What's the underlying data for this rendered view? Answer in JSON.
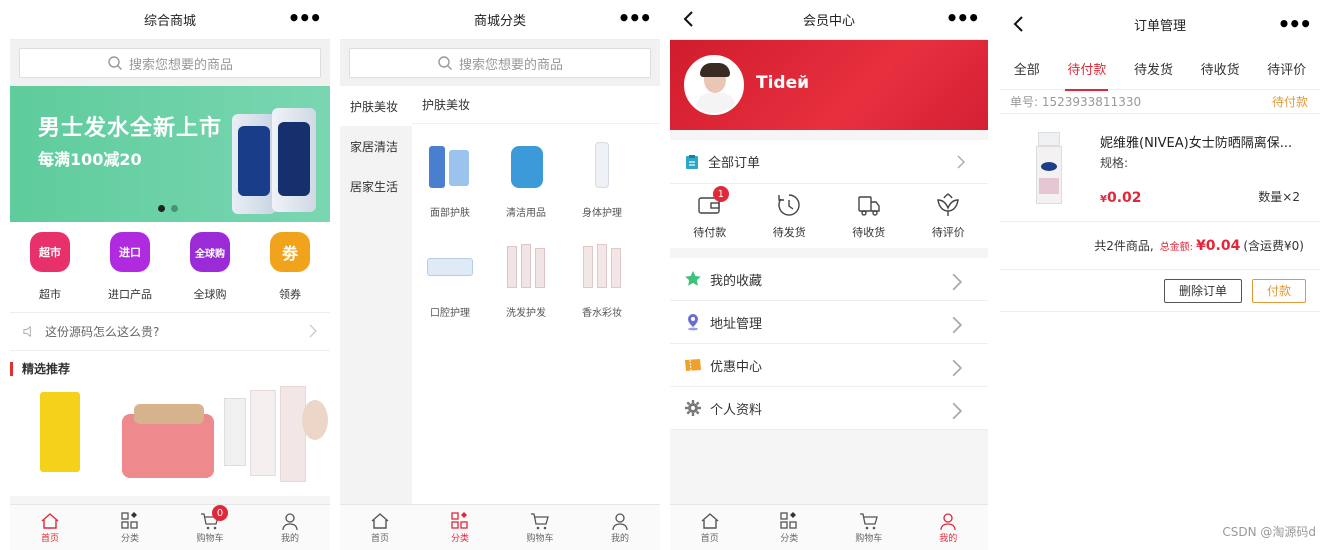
{
  "screens": {
    "home": {
      "title": "综合商城",
      "search_placeholder": "搜索您想要的商品",
      "banner": {
        "title": "男士发水全新上市",
        "sub": "每满100减20"
      },
      "categories": [
        {
          "icon": "supermarket-icon",
          "text": "超市",
          "label": "超市",
          "color": "#e8306a"
        },
        {
          "icon": "import-icon",
          "text": "进口",
          "label": "进口产品",
          "color": "#b02be0"
        },
        {
          "icon": "global-icon",
          "text": "全球购",
          "label": "全球购",
          "color": "#9b2bd6"
        },
        {
          "icon": "coupon-icon",
          "text": "劵",
          "label": "领券",
          "color": "#f2a31c"
        }
      ],
      "notice": "这份源码怎么这么贵?",
      "section_title": "精选推荐",
      "tabbar": [
        {
          "icon": "home-icon",
          "label": "首页"
        },
        {
          "icon": "category-icon",
          "label": "分类"
        },
        {
          "icon": "cart-icon",
          "label": "购物车"
        },
        {
          "icon": "user-icon",
          "label": "我的"
        }
      ],
      "cart_badge": "0"
    },
    "category": {
      "title": "商城分类",
      "search_placeholder": "搜索您想要的商品",
      "sidebar": [
        "护肤美妆",
        "家居清洁",
        "居家生活"
      ],
      "main_title": "护肤美妆",
      "grid": [
        "面部护肤",
        "清洁用品",
        "身体护理",
        "口腔护理",
        "洗发护发",
        "香水彩妆"
      ],
      "tabbar": [
        {
          "icon": "home-icon",
          "label": "首页"
        },
        {
          "icon": "category-icon",
          "label": "分类"
        },
        {
          "icon": "cart-icon",
          "label": "购物车"
        },
        {
          "icon": "user-icon",
          "label": "我的"
        }
      ]
    },
    "member": {
      "title": "会员中心",
      "username": "Tideй",
      "all_orders": "全部订单",
      "order_stats": [
        {
          "icon": "wallet-icon",
          "label": "待付款",
          "badge": "1"
        },
        {
          "icon": "clock-icon",
          "label": "待发货"
        },
        {
          "icon": "truck-icon",
          "label": "待收货"
        },
        {
          "icon": "flower-icon",
          "label": "待评价"
        }
      ],
      "menu": [
        {
          "icon": "star-icon",
          "label": "我的收藏"
        },
        {
          "icon": "location-icon",
          "label": "地址管理"
        },
        {
          "icon": "ticket-icon",
          "label": "优惠中心"
        },
        {
          "icon": "gear-icon",
          "label": "个人资料"
        }
      ],
      "tabbar": [
        {
          "icon": "home-icon",
          "label": "首页"
        },
        {
          "icon": "category-icon",
          "label": "分类"
        },
        {
          "icon": "cart-icon",
          "label": "购物车"
        },
        {
          "icon": "user-icon",
          "label": "我的"
        }
      ]
    },
    "orders": {
      "title": "订单管理",
      "tabs": [
        "全部",
        "待付款",
        "待发货",
        "待收货",
        "待评价"
      ],
      "order_no": "单号: 1523933811330",
      "status": "待付款",
      "product_name": "妮维雅(NIVEA)女士防晒隔离保...",
      "spec": "规格:",
      "price_symbol": "¥",
      "price": "0.02",
      "qty": "数量×2",
      "summary_count": "共2件商品,",
      "summary_label": "总金额:",
      "summary_amount": "¥0.04",
      "summary_freight": "(含运费¥0)",
      "btn_delete": "删除订单",
      "btn_pay": "付款"
    }
  },
  "watermark": "CSDN @淘源码d",
  "colors": {
    "accent": "#e0283a",
    "banner": "#5ecc9c",
    "pending": "#e09a3a"
  }
}
